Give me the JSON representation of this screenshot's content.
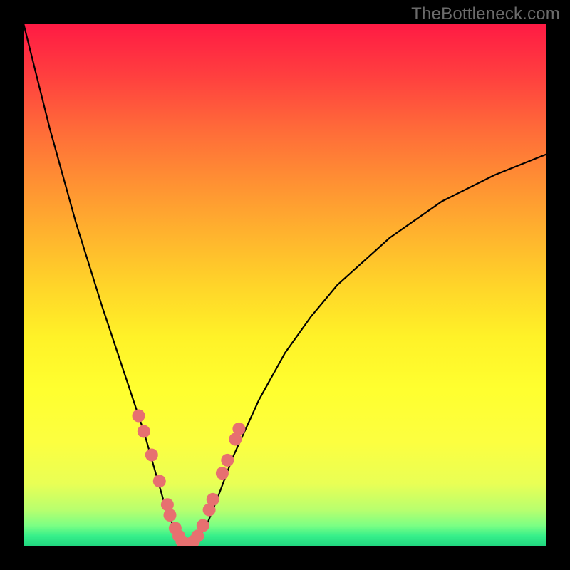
{
  "watermark": "TheBottleneck.com",
  "chart_data": {
    "type": "line",
    "title": "",
    "xlabel": "",
    "ylabel": "",
    "xlim": [
      0,
      100
    ],
    "ylim": [
      0,
      100
    ],
    "series": [
      {
        "name": "bottleneck-curve",
        "x": [
          0,
          5,
          10,
          15,
          18,
          21,
          23,
          25,
          27,
          29,
          30,
          31,
          32,
          33,
          35,
          37,
          40,
          45,
          50,
          55,
          60,
          70,
          80,
          90,
          100
        ],
        "values": [
          100,
          80,
          62,
          46,
          37,
          28,
          22,
          15,
          8,
          3,
          1,
          0,
          0,
          1,
          4,
          9,
          17,
          28,
          37,
          44,
          50,
          59,
          66,
          71,
          75
        ]
      }
    ],
    "markers": {
      "name": "highlight-points",
      "x": [
        22,
        23,
        24.5,
        26,
        27.5,
        28,
        29,
        29.7,
        30.3,
        31,
        31.8,
        32.5,
        33.3,
        34.3,
        35.5,
        36.2,
        38,
        39,
        40.5,
        41.2
      ],
      "values": [
        25,
        22,
        17.5,
        12.5,
        8,
        6,
        3.5,
        2,
        1,
        0.5,
        0.5,
        1,
        2,
        4,
        7,
        9,
        14,
        16.5,
        20.5,
        22.5
      ]
    }
  },
  "colors": {
    "curve": "#000000",
    "marker": "#e77070",
    "gradient_top": "#ff1a44",
    "gradient_bottom": "#1fd67f"
  }
}
